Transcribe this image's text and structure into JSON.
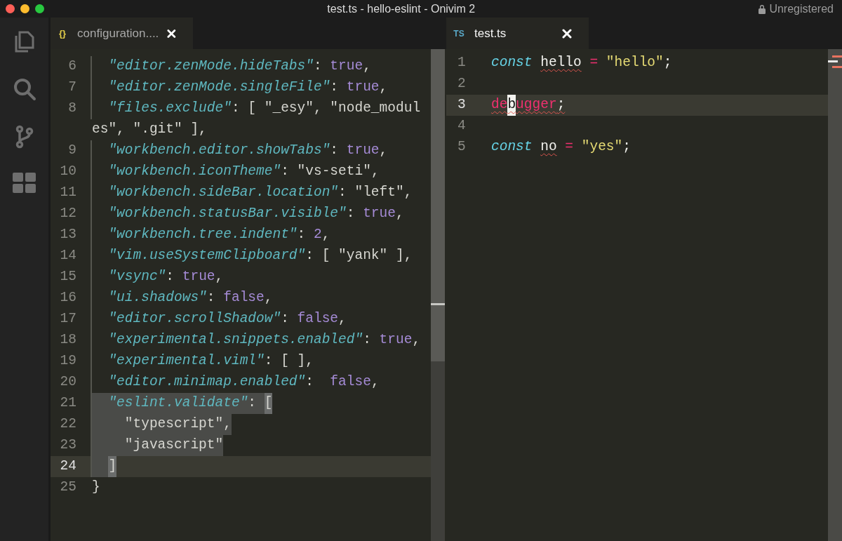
{
  "window": {
    "title": "test.ts - hello-eslint - Onivim 2",
    "license": "Unregistered"
  },
  "activity_bar": [
    {
      "kind": "files"
    },
    {
      "kind": "search"
    },
    {
      "kind": "source-control"
    },
    {
      "kind": "extensions"
    }
  ],
  "panes": [
    {
      "tab": {
        "icon": "{}",
        "color": "#e6d04a",
        "label": "configuration....",
        "selected": false
      },
      "lines": [
        {
          "kind": "line",
          "number": "6",
          "guide": true,
          "current": false,
          "selected": false,
          "tokens": [
            {
              "kind": "key",
              "text": "  \"editor.zenMode.hideTabs\""
            },
            {
              "kind": "punct",
              "text": ": "
            },
            {
              "kind": "bool",
              "text": "true"
            },
            {
              "kind": "punct",
              "text": ","
            }
          ]
        },
        {
          "kind": "line",
          "number": "7",
          "guide": true,
          "current": false,
          "selected": false,
          "tokens": [
            {
              "kind": "key",
              "text": "  \"editor.zenMode.singleFile\""
            },
            {
              "kind": "punct",
              "text": ": "
            },
            {
              "kind": "bool",
              "text": "true"
            },
            {
              "kind": "punct",
              "text": ","
            }
          ]
        },
        {
          "kind": "line",
          "number": "8",
          "guide": true,
          "current": false,
          "selected": false,
          "tokens": [
            {
              "kind": "key",
              "text": "  \"files.exclude\""
            },
            {
              "kind": "punct",
              "text": ": [ \"_esy\", \"node_modul"
            }
          ]
        },
        {
          "kind": "wrap",
          "guide": false,
          "current": false,
          "selected": false,
          "tokens": [
            {
              "kind": "punct",
              "text": "es\", \".git\" ],"
            }
          ]
        },
        {
          "kind": "line",
          "number": "9",
          "guide": true,
          "current": false,
          "selected": false,
          "tokens": [
            {
              "kind": "key",
              "text": "  \"workbench.editor.showTabs\""
            },
            {
              "kind": "punct",
              "text": ": "
            },
            {
              "kind": "bool",
              "text": "true"
            },
            {
              "kind": "punct",
              "text": ","
            }
          ]
        },
        {
          "kind": "line",
          "number": "10",
          "guide": true,
          "current": false,
          "selected": false,
          "tokens": [
            {
              "kind": "key",
              "text": "  \"workbench.iconTheme\""
            },
            {
              "kind": "punct",
              "text": ": \"vs-seti\","
            }
          ]
        },
        {
          "kind": "line",
          "number": "11",
          "guide": true,
          "current": false,
          "selected": false,
          "tokens": [
            {
              "kind": "key",
              "text": "  \"workbench.sideBar.location\""
            },
            {
              "kind": "punct",
              "text": ": \"left\","
            }
          ]
        },
        {
          "kind": "line",
          "number": "12",
          "guide": true,
          "current": false,
          "selected": false,
          "tokens": [
            {
              "kind": "key",
              "text": "  \"workbench.statusBar.visible\""
            },
            {
              "kind": "punct",
              "text": ": "
            },
            {
              "kind": "bool",
              "text": "true"
            },
            {
              "kind": "punct",
              "text": ","
            }
          ]
        },
        {
          "kind": "line",
          "number": "13",
          "guide": true,
          "current": false,
          "selected": false,
          "tokens": [
            {
              "kind": "key",
              "text": "  \"workbench.tree.indent\""
            },
            {
              "kind": "punct",
              "text": ": "
            },
            {
              "kind": "bool",
              "text": "2"
            },
            {
              "kind": "punct",
              "text": ","
            }
          ]
        },
        {
          "kind": "line",
          "number": "14",
          "guide": true,
          "current": false,
          "selected": false,
          "tokens": [
            {
              "kind": "key",
              "text": "  \"vim.useSystemClipboard\""
            },
            {
              "kind": "punct",
              "text": ": [ \"yank\" ],"
            }
          ]
        },
        {
          "kind": "line",
          "number": "15",
          "guide": true,
          "current": false,
          "selected": false,
          "tokens": [
            {
              "kind": "key",
              "text": "  \"vsync\""
            },
            {
              "kind": "punct",
              "text": ": "
            },
            {
              "kind": "bool",
              "text": "true"
            },
            {
              "kind": "punct",
              "text": ","
            }
          ]
        },
        {
          "kind": "line",
          "number": "16",
          "guide": true,
          "current": false,
          "selected": false,
          "tokens": [
            {
              "kind": "key",
              "text": "  \"ui.shadows\""
            },
            {
              "kind": "punct",
              "text": ": "
            },
            {
              "kind": "bool",
              "text": "false"
            },
            {
              "kind": "punct",
              "text": ","
            }
          ]
        },
        {
          "kind": "line",
          "number": "17",
          "guide": true,
          "current": false,
          "selected": false,
          "tokens": [
            {
              "kind": "key",
              "text": "  \"editor.scrollShadow\""
            },
            {
              "kind": "punct",
              "text": ": "
            },
            {
              "kind": "bool",
              "text": "false"
            },
            {
              "kind": "punct",
              "text": ","
            }
          ]
        },
        {
          "kind": "line",
          "number": "18",
          "guide": true,
          "current": false,
          "selected": false,
          "tokens": [
            {
              "kind": "key",
              "text": "  \"experimental.snippets.enabled\""
            },
            {
              "kind": "punct",
              "text": ": "
            },
            {
              "kind": "bool",
              "text": "true"
            },
            {
              "kind": "punct",
              "text": ","
            }
          ]
        },
        {
          "kind": "line",
          "number": "19",
          "guide": true,
          "current": false,
          "selected": false,
          "tokens": [
            {
              "kind": "key",
              "text": "  \"experimental.viml\""
            },
            {
              "kind": "punct",
              "text": ": [ ],"
            }
          ]
        },
        {
          "kind": "line",
          "number": "20",
          "guide": true,
          "current": false,
          "selected": false,
          "tokens": [
            {
              "kind": "key",
              "text": "  \"editor.minimap.enabled\""
            },
            {
              "kind": "punct",
              "text": ":  "
            },
            {
              "kind": "bool",
              "text": "false"
            },
            {
              "kind": "punct",
              "text": ","
            }
          ]
        },
        {
          "kind": "line",
          "number": "21",
          "guide": true,
          "current": false,
          "selected": true,
          "tokens": [
            {
              "kind": "key",
              "text": "  \"eslint.validate\""
            },
            {
              "kind": "punct",
              "text": ": "
            },
            {
              "kind": "match",
              "text": "["
            }
          ]
        },
        {
          "kind": "line",
          "number": "22",
          "guide": true,
          "current": false,
          "selected": true,
          "tokens": [
            {
              "kind": "punct",
              "text": "    \"typescript\","
            }
          ]
        },
        {
          "kind": "line",
          "number": "23",
          "guide": true,
          "current": false,
          "selected": true,
          "tokens": [
            {
              "kind": "punct",
              "text": "    \"javascript\""
            }
          ]
        },
        {
          "kind": "line",
          "number": "24",
          "guide": true,
          "current": true,
          "selected": true,
          "tokens": [
            {
              "kind": "match",
              "text": "  ]"
            }
          ]
        },
        {
          "kind": "line",
          "number": "25",
          "guide": false,
          "current": false,
          "selected": false,
          "tokens": [
            {
              "kind": "punct",
              "text": "}"
            }
          ]
        }
      ]
    },
    {
      "tab": {
        "icon": "TS",
        "color": "#5aa9c9",
        "label": "test.ts",
        "selected": true
      },
      "lines": [
        {
          "kind": "line",
          "number": "1",
          "guide": false,
          "current": false,
          "selected": false,
          "tokens": [
            {
              "kind": "decl",
              "text": "const "
            },
            {
              "kind": "ident",
              "text": "hello",
              "error": true
            },
            {
              "kind": "op",
              "text": " = "
            },
            {
              "kind": "string",
              "text": "\"hello\""
            },
            {
              "kind": "ident",
              "text": ";"
            }
          ]
        },
        {
          "kind": "line",
          "number": "2",
          "guide": false,
          "current": false,
          "selected": false
        },
        {
          "kind": "line",
          "number": "3",
          "guide": false,
          "current": true,
          "selected": false,
          "tokens": [
            {
              "kind": "op",
              "text": "de",
              "error": true
            },
            {
              "kind": "cursor",
              "text": "b",
              "error": true
            },
            {
              "kind": "op",
              "text": "ugger",
              "error": true
            },
            {
              "kind": "ident",
              "text": ";",
              "error": true
            }
          ]
        },
        {
          "kind": "line",
          "number": "4",
          "guide": false,
          "current": false,
          "selected": false
        },
        {
          "kind": "line",
          "number": "5",
          "guide": false,
          "current": false,
          "selected": false,
          "tokens": [
            {
              "kind": "decl",
              "text": "const "
            },
            {
              "kind": "ident",
              "text": "no",
              "error": true
            },
            {
              "kind": "op",
              "text": " = "
            },
            {
              "kind": "string",
              "text": "\"yes\""
            },
            {
              "kind": "ident",
              "text": ";"
            }
          ]
        }
      ]
    }
  ]
}
